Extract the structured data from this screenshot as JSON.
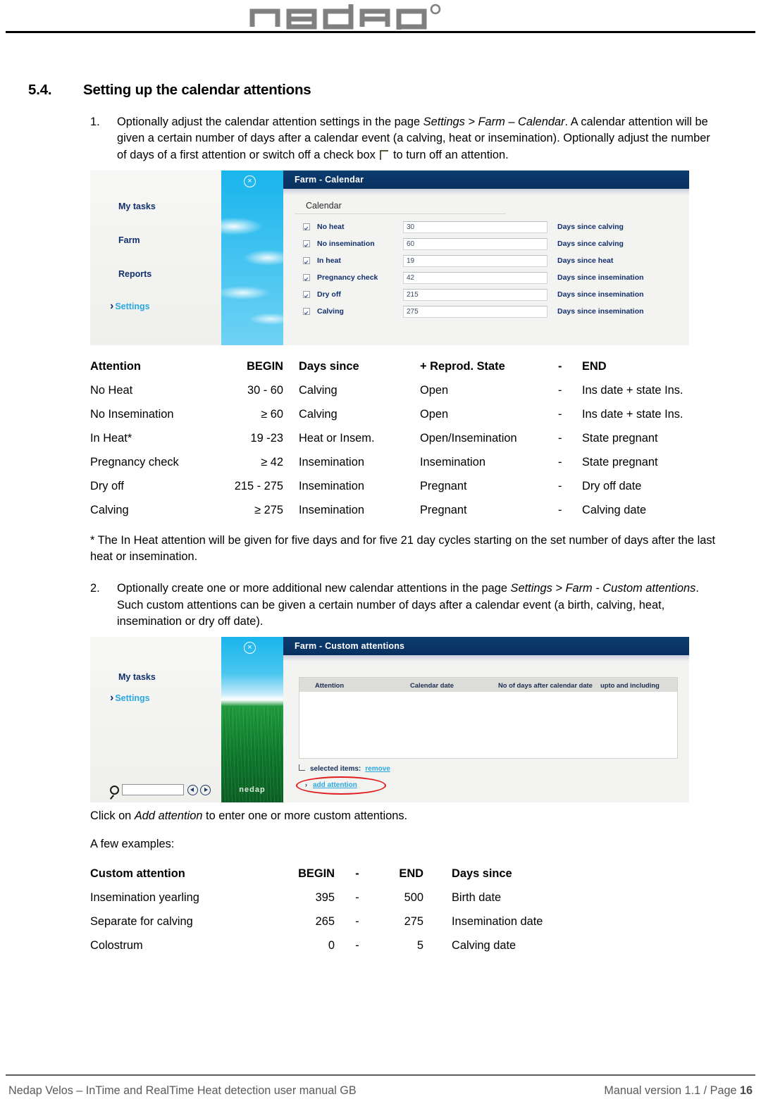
{
  "header": {
    "logo_text": "nedap",
    "logo_registered": "®"
  },
  "section": {
    "number": "5.4.",
    "title": "Setting up the calendar attentions"
  },
  "step1": {
    "marker": "1.",
    "part1": "Optionally adjust the calendar attention settings in the page ",
    "italic1": "Settings > Farm – Calendar",
    "part2": ". A calendar attention will be given a certain number of days after a calendar event (a calving, heat or insemination). Optionally adjust the number of days of a first attention or switch off a check box ",
    "part3": " to turn off an attention."
  },
  "screenshot1": {
    "window_title": "Farm - Calendar",
    "close_icon": "×",
    "sidebar": [
      "My tasks",
      "Farm",
      "Reports",
      "Settings"
    ],
    "settings_caret": "›",
    "form_section_label": "Calendar",
    "rows": [
      {
        "label": "No heat",
        "value": "30",
        "unit": "Days since calving"
      },
      {
        "label": "No insemination",
        "value": "60",
        "unit": "Days since calving"
      },
      {
        "label": "In heat",
        "value": "19",
        "unit": "Days since heat"
      },
      {
        "label": "Pregnancy check",
        "value": "42",
        "unit": "Days since insemination"
      },
      {
        "label": "Dry off",
        "value": "215",
        "unit": "Days since insemination"
      },
      {
        "label": "Calving",
        "value": "275",
        "unit": "Days since insemination"
      }
    ]
  },
  "table1": {
    "headers": [
      "Attention",
      "BEGIN",
      "Days since",
      "+  Reprod. State",
      "-",
      "END"
    ],
    "rows": [
      [
        "No Heat",
        "30 - 60",
        "Calving",
        "Open",
        "-",
        "Ins date + state Ins."
      ],
      [
        "No Insemination",
        "≥ 60",
        "Calving",
        "Open",
        "-",
        "Ins date + state Ins."
      ],
      [
        "In Heat*",
        "19 -23",
        "Heat or Insem.",
        "Open/Insemination",
        "-",
        "State pregnant"
      ],
      [
        "Pregnancy check",
        "≥ 42",
        "Insemination",
        "Insemination",
        "-",
        "State pregnant"
      ],
      [
        "Dry off",
        "215 - 275",
        "Insemination",
        "Pregnant",
        "-",
        "Dry off date"
      ],
      [
        "Calving",
        "≥ 275",
        "Insemination",
        "Pregnant",
        "-",
        "Calving date"
      ]
    ]
  },
  "footnote": "* The In Heat attention will be given for five days and for five 21 day cycles starting on the set number of days after the last heat or insemination.",
  "step2": {
    "marker": "2.",
    "part1": "Optionally create one or more additional new calendar attentions in the page ",
    "italic1": "Settings > Farm - Custom attentions",
    "part2": ". Such custom attentions can be given a certain number of days after a calendar event (a birth, calving, heat, insemination or dry off date)."
  },
  "screenshot2": {
    "window_title": "Farm - Custom attentions",
    "close_icon": "×",
    "sidebar": [
      "My tasks",
      "Settings"
    ],
    "settings_caret": "›",
    "table_headers": [
      "Attention",
      "Calendar date",
      "No of days after calendar date",
      "upto and including"
    ],
    "selected_items_label": "selected items:",
    "remove_link": "remove",
    "add_attention_link": "add attention",
    "add_caret": "›",
    "strip_logo": "nedap",
    "highlight_color": "#e01b1b"
  },
  "click_para": {
    "part1": "Click on ",
    "italic1": "Add attention",
    "part2": " to enter one or more custom attentions."
  },
  "examples_intro": "A few examples:",
  "table2": {
    "headers": [
      "Custom attention",
      "BEGIN",
      "-",
      "END",
      "Days since"
    ],
    "rows": [
      [
        "Insemination yearling",
        "395",
        "-",
        "500",
        "Birth date"
      ],
      [
        "Separate for calving",
        "265",
        "-",
        "275",
        "Insemination date"
      ],
      [
        "Colostrum",
        "0",
        "-",
        "5",
        "Calving date"
      ]
    ]
  },
  "footer": {
    "left": "Nedap Velos – InTime and RealTime Heat detection user manual GB",
    "right_prefix": "Manual version 1.1 / Page ",
    "page_number": "16"
  }
}
